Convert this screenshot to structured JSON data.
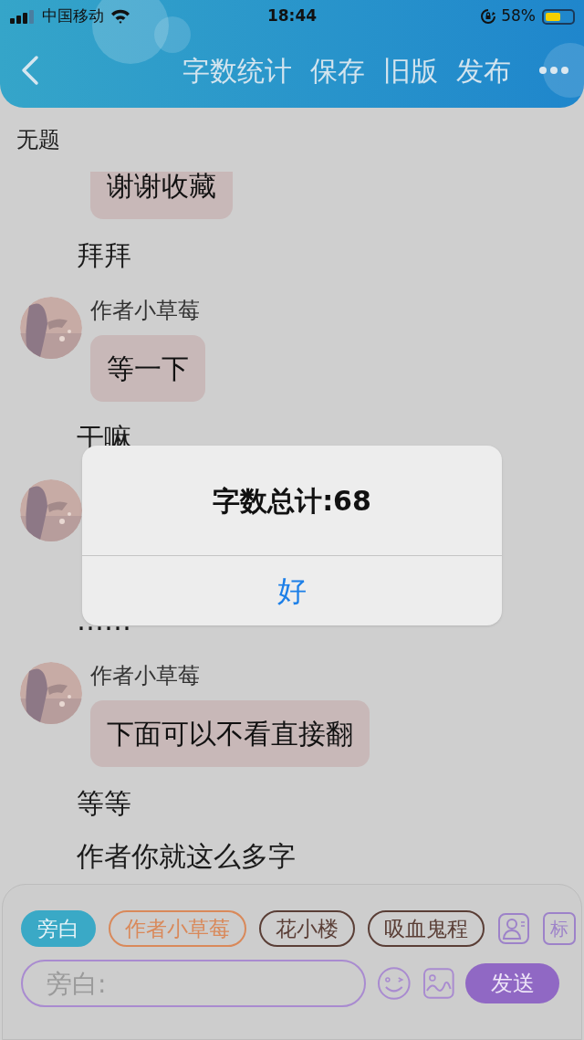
{
  "status_bar": {
    "carrier": "中国移动",
    "time": "18:44",
    "battery_text": "58%"
  },
  "toolbar": {
    "actions": [
      "字数统计",
      "保存",
      "旧版",
      "发布"
    ]
  },
  "title": "无题",
  "messages": [
    {
      "kind": "character",
      "avatar": false,
      "text": "谢谢收藏"
    },
    {
      "kind": "narration",
      "text": "拜拜"
    },
    {
      "kind": "character",
      "avatar": true,
      "name": "作者小草莓",
      "text": "等一下"
    },
    {
      "kind": "narration",
      "text": "干嘛"
    },
    {
      "kind": "character",
      "avatar": true
    },
    {
      "kind": "narration",
      "text": "……"
    },
    {
      "kind": "character",
      "avatar": true,
      "name": "作者小草莓",
      "text": "下面可以不看直接翻"
    },
    {
      "kind": "narration",
      "text": "等等"
    },
    {
      "kind": "narration",
      "text": "作者你就这么多字"
    }
  ],
  "roles": [
    {
      "label": "旁白",
      "selected": true,
      "color": "#3aa9c6"
    },
    {
      "label": "作者小草莓",
      "selected": false,
      "color": "#d9895a"
    },
    {
      "label": "花小楼",
      "selected": false,
      "color": "#5a3e36"
    },
    {
      "label": "吸血鬼程",
      "selected": false,
      "color": "#5a3e36"
    }
  ],
  "mark_button": "标",
  "input": {
    "placeholder": "旁白:"
  },
  "send_button": "发送",
  "alert": {
    "title": "字数总计:68",
    "button": "好"
  }
}
